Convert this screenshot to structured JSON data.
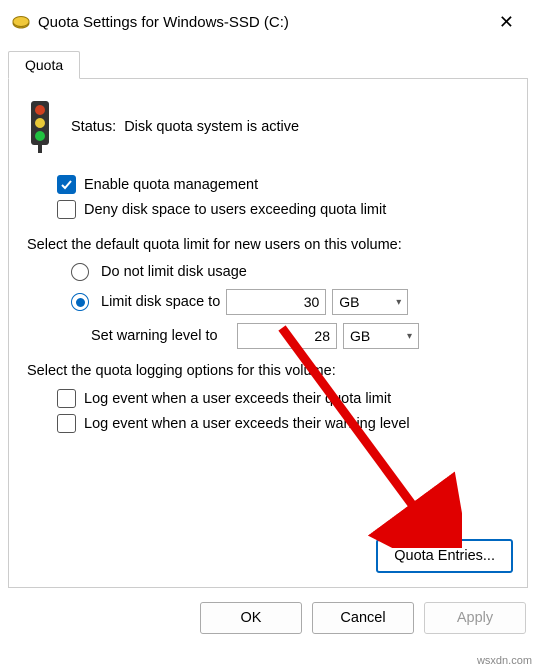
{
  "titlebar": {
    "title": "Quota Settings for Windows-SSD (C:)"
  },
  "tab": {
    "label": "Quota"
  },
  "status": {
    "label": "Status:",
    "text": "Disk quota system is active"
  },
  "options": {
    "enable_quota": "Enable quota management",
    "deny_space": "Deny disk space to users exceeding quota limit"
  },
  "limit_section": {
    "heading": "Select the default quota limit for new users on this volume:",
    "no_limit": "Do not limit disk usage",
    "limit_to": "Limit disk space to",
    "limit_value": "30",
    "limit_unit": "GB",
    "warning_label": "Set warning level to",
    "warning_value": "28",
    "warning_unit": "GB"
  },
  "logging": {
    "heading": "Select the quota logging options for this volume:",
    "log_quota": "Log event when a user exceeds their quota limit",
    "log_warning": "Log event when a user exceeds their warning level"
  },
  "quota_entries_btn": "Quota Entries...",
  "buttons": {
    "ok": "OK",
    "cancel": "Cancel",
    "apply": "Apply"
  },
  "watermark": "wsxdn.com"
}
